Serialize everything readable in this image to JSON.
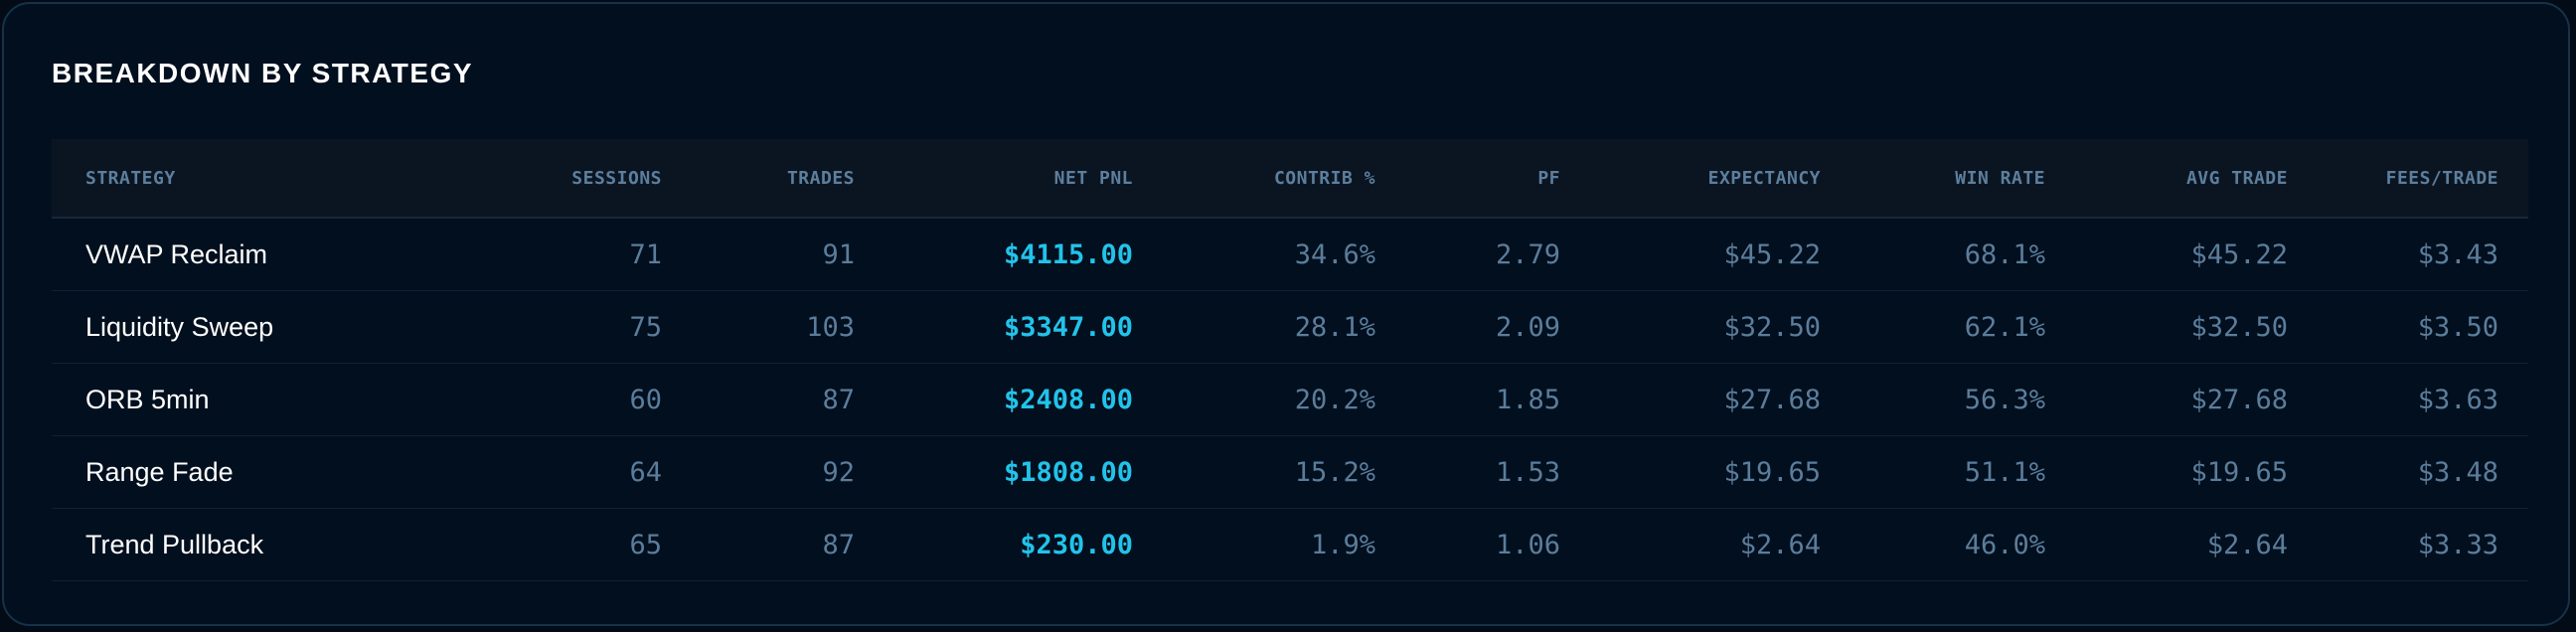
{
  "panel": {
    "title": "BREAKDOWN BY STRATEGY"
  },
  "table": {
    "headers": [
      "STRATEGY",
      "SESSIONS",
      "TRADES",
      "NET PNL",
      "CONTRIB %",
      "PF",
      "EXPECTANCY",
      "WIN RATE",
      "AVG TRADE",
      "FEES/TRADE"
    ],
    "rows": [
      [
        "VWAP Reclaim",
        "71",
        "91",
        "$4115.00",
        "34.6%",
        "2.79",
        "$45.22",
        "68.1%",
        "$45.22",
        "$3.43"
      ],
      [
        "Liquidity Sweep",
        "75",
        "103",
        "$3347.00",
        "28.1%",
        "2.09",
        "$32.50",
        "62.1%",
        "$32.50",
        "$3.50"
      ],
      [
        "ORB 5min",
        "60",
        "87",
        "$2408.00",
        "20.2%",
        "1.85",
        "$27.68",
        "56.3%",
        "$27.68",
        "$3.63"
      ],
      [
        "Range Fade",
        "64",
        "92",
        "$1808.00",
        "15.2%",
        "1.53",
        "$19.65",
        "51.1%",
        "$19.65",
        "$3.48"
      ],
      [
        "Trend Pullback",
        "65",
        "87",
        "$230.00",
        "1.9%",
        "1.06",
        "$2.64",
        "46.0%",
        "$2.64",
        "$3.33"
      ]
    ]
  },
  "colors": {
    "background": "#020f1e",
    "header_background": "#0b1521",
    "accent_pnl": "#22c3ea",
    "muted_text": "#5b7d9b",
    "primary_text": "#ffffff"
  }
}
